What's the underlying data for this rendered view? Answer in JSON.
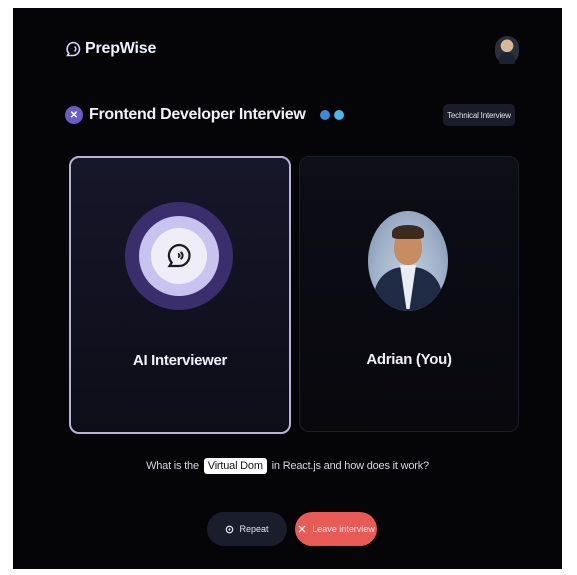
{
  "header": {
    "brand": "PrepWise",
    "logo_icon": "chat-bubble-icon",
    "user_avatar": "user-avatar"
  },
  "interview": {
    "title": "Frontend Developer Interview",
    "badge_icon": "interview-role-icon",
    "tech_icons": [
      "react-icon",
      "tailwind-icon"
    ],
    "type_tag": "Technical Interview"
  },
  "participants": {
    "ai": {
      "label": "AI Interviewer",
      "icon": "ai-voice-icon"
    },
    "user": {
      "label": "Adrian (You)",
      "photo": "user-photo"
    }
  },
  "question": {
    "prefix": "What is the",
    "highlight": "Virtual Dom",
    "suffix": "in React.js and how does it work?"
  },
  "actions": {
    "repeat": {
      "label": "Repeat",
      "icon": "repeat-icon"
    },
    "leave": {
      "label": "Leave interview",
      "icon": "leave-call-icon"
    }
  },
  "colors": {
    "background": "#050507",
    "ai_ring": "#3a2f6c",
    "ai_card_border": "#b7b2d8",
    "leave_button": "#e85a56",
    "repeat_button": "#1a1d2c"
  }
}
